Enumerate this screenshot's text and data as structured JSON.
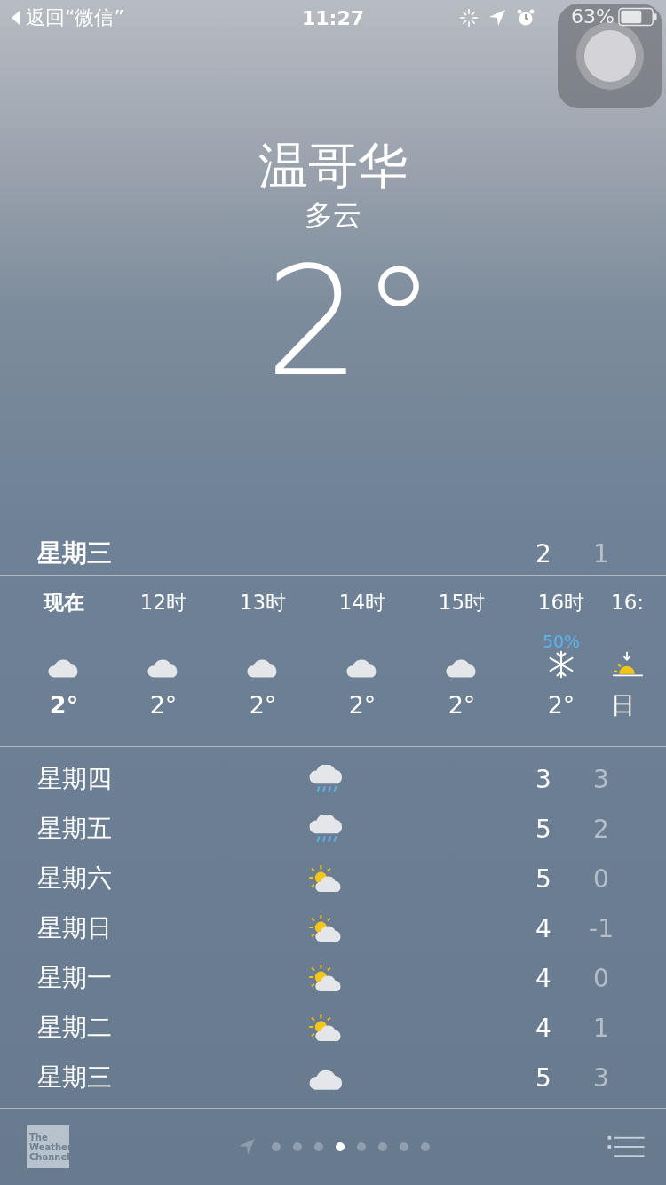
{
  "status_bar": {
    "back_label": "返回“微信”",
    "time": "11:27",
    "battery_text": "63%"
  },
  "location": {
    "city": "温哥华",
    "condition": "多云",
    "temperature": "2°"
  },
  "today": {
    "day": "星期三",
    "high": "2",
    "low": "1"
  },
  "hourly": [
    {
      "time": "现在",
      "kind": "cloud",
      "temp": "2°",
      "current": true
    },
    {
      "time": "12时",
      "kind": "cloud",
      "temp": "2°",
      "current": false
    },
    {
      "time": "13时",
      "kind": "cloud",
      "temp": "2°",
      "current": false
    },
    {
      "time": "14时",
      "kind": "cloud",
      "temp": "2°",
      "current": false
    },
    {
      "time": "15时",
      "kind": "cloud",
      "temp": "2°",
      "current": false
    },
    {
      "time": "16时",
      "kind": "snow",
      "precip": "50%",
      "temp": "2°",
      "current": false
    },
    {
      "time": "16:",
      "kind": "sunset",
      "temp": "日",
      "current": false
    }
  ],
  "daily": [
    {
      "day": "星期四",
      "kind": "rain",
      "high": "3",
      "low": "3"
    },
    {
      "day": "星期五",
      "kind": "rain",
      "high": "5",
      "low": "2"
    },
    {
      "day": "星期六",
      "kind": "partly_sunny",
      "high": "5",
      "low": "0"
    },
    {
      "day": "星期日",
      "kind": "partly_sunny",
      "high": "4",
      "low": "-1"
    },
    {
      "day": "星期一",
      "kind": "partly_sunny",
      "high": "4",
      "low": "0"
    },
    {
      "day": "星期二",
      "kind": "partly_sunny",
      "high": "4",
      "low": "1"
    },
    {
      "day": "星期三",
      "kind": "cloud",
      "high": "5",
      "low": "3"
    }
  ],
  "footer": {
    "logo_lines": [
      "The",
      "Weather",
      "Channel"
    ],
    "pages": [
      {
        "selected": false
      },
      {
        "selected": false
      },
      {
        "selected": false
      },
      {
        "selected": true
      },
      {
        "selected": false
      },
      {
        "selected": false
      },
      {
        "selected": false
      },
      {
        "selected": false
      }
    ]
  }
}
